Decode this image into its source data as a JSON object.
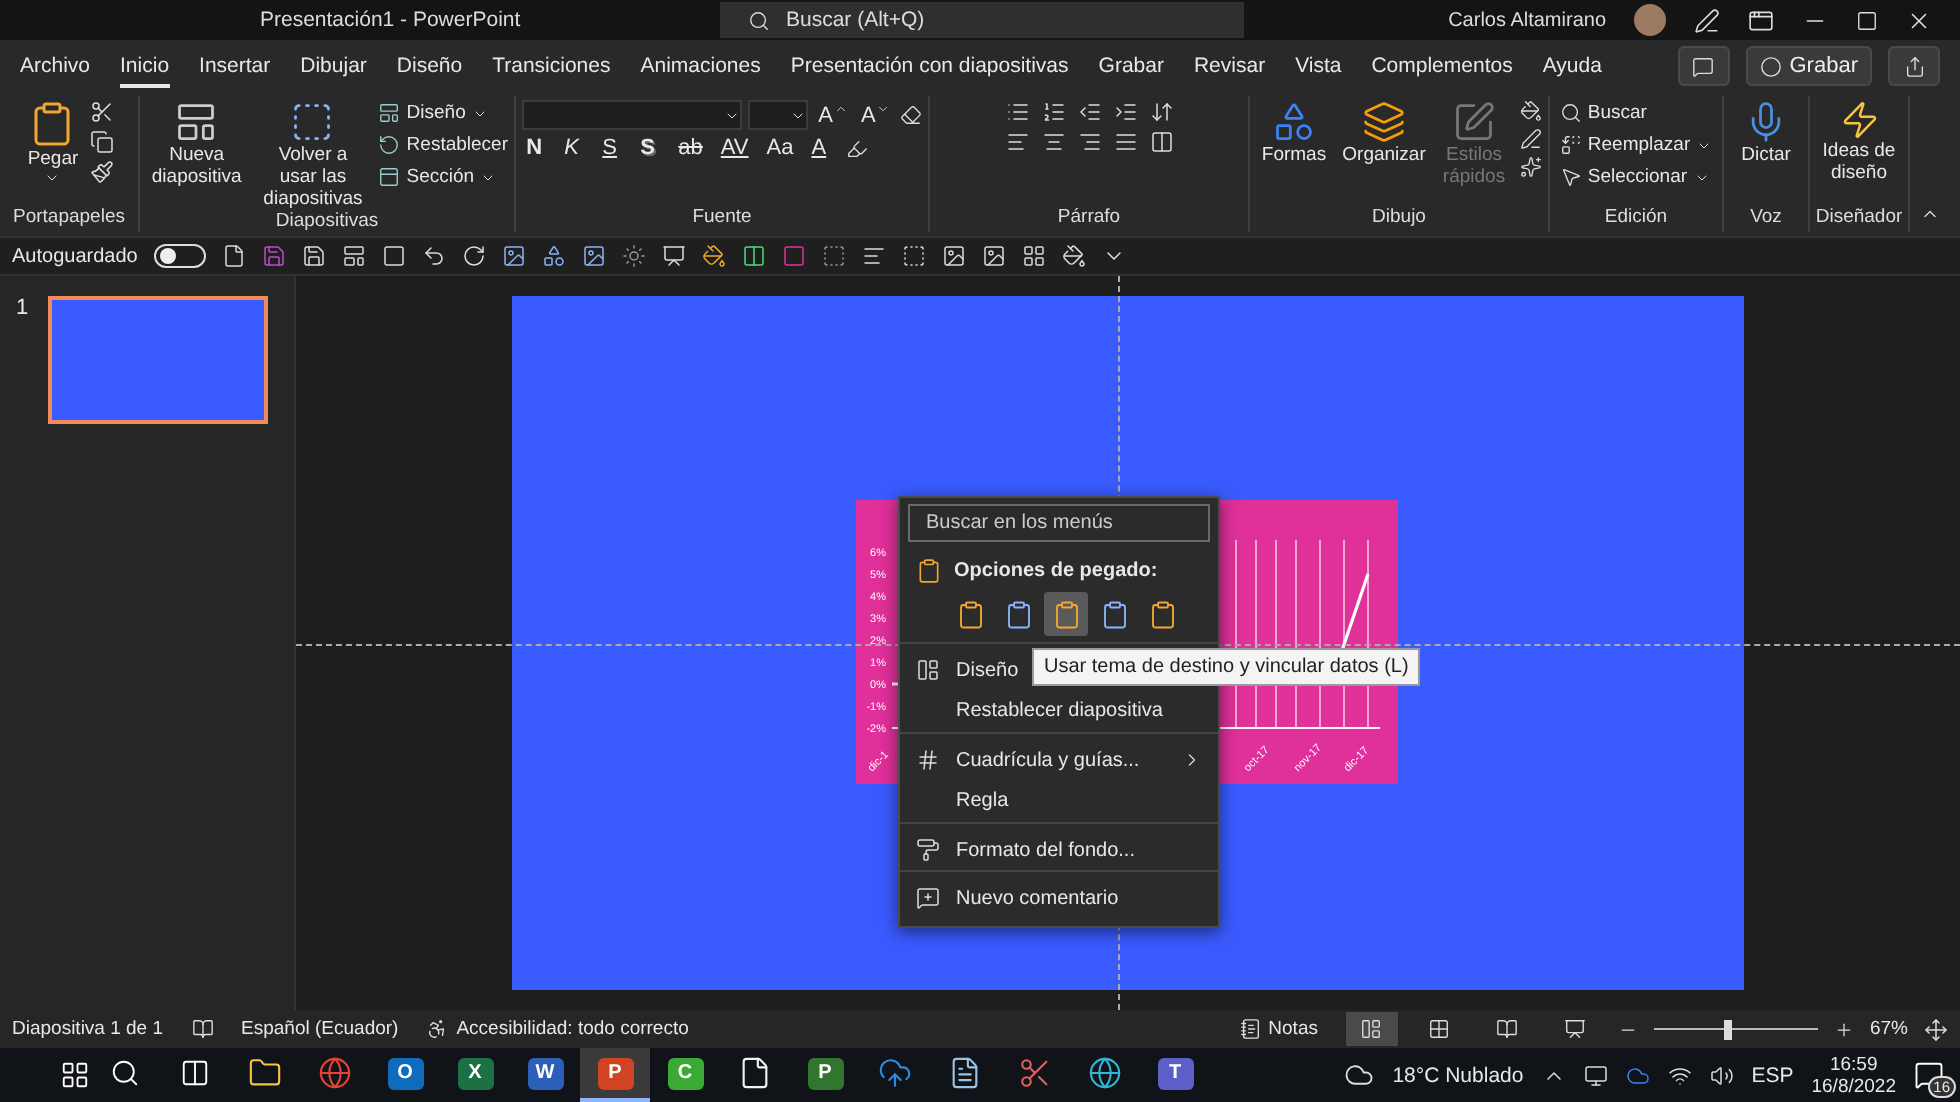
{
  "title_bar": {
    "document_title": "Presentación1  -  PowerPoint",
    "search_placeholder": "Buscar (Alt+Q)",
    "user_name": "Carlos Altamirano"
  },
  "menu_tabs": [
    {
      "label": "Archivo",
      "selected": false
    },
    {
      "label": "Inicio",
      "selected": true
    },
    {
      "label": "Insertar",
      "selected": false
    },
    {
      "label": "Dibujar",
      "selected": false
    },
    {
      "label": "Diseño",
      "selected": false
    },
    {
      "label": "Transiciones",
      "selected": false
    },
    {
      "label": "Animaciones",
      "selected": false
    },
    {
      "label": "Presentación con diapositivas",
      "selected": false
    },
    {
      "label": "Grabar",
      "selected": false
    },
    {
      "label": "Revisar",
      "selected": false
    },
    {
      "label": "Vista",
      "selected": false
    },
    {
      "label": "Complementos",
      "selected": false
    },
    {
      "label": "Ayuda",
      "selected": false
    }
  ],
  "record_button": "Grabar",
  "ribbon": {
    "clipboard": {
      "label": "Portapapeles",
      "paste": "Pegar"
    },
    "slides": {
      "label": "Diapositivas",
      "new_slide": "Nueva diapositiva",
      "reuse": "Volver a usar las diapositivas",
      "small": [
        {
          "label": "Diseño",
          "kind": "layout",
          "dropdown": true
        },
        {
          "label": "Restablecer",
          "kind": "reset",
          "dropdown": false
        },
        {
          "label": "Sección",
          "kind": "section",
          "dropdown": true
        }
      ]
    },
    "font": {
      "label": "Fuente",
      "size_buttons": [
        {
          "label": "A",
          "kind": "grow"
        },
        {
          "label": "A",
          "kind": "shrink"
        }
      ],
      "format_buttons": [
        {
          "label": "N",
          "kind": "bold"
        },
        {
          "label": "K",
          "kind": "italic"
        },
        {
          "label": "S",
          "kind": "underline"
        },
        {
          "label": "S",
          "kind": "shadow"
        },
        {
          "label": "ab",
          "kind": "strike"
        },
        {
          "label": "AV",
          "kind": "spacing"
        },
        {
          "label": "Aa",
          "kind": "case"
        },
        {
          "label": "A",
          "kind": "color"
        }
      ]
    },
    "paragraph": {
      "label": "Párrafo"
    },
    "drawing": {
      "label": "Dibujo",
      "buttons": [
        {
          "label": "Formas",
          "kind": "shapes",
          "disabled": false
        },
        {
          "label": "Organizar",
          "kind": "arrange",
          "disabled": false
        },
        {
          "label": "Estilos rápidos",
          "kind": "styles",
          "disabled": true
        }
      ]
    },
    "editing": {
      "label": "Edición",
      "buttons": [
        {
          "label": "Buscar",
          "kind": "find",
          "dropdown": false
        },
        {
          "label": "Reemplazar",
          "kind": "replace",
          "dropdown": true
        },
        {
          "label": "Seleccionar",
          "kind": "select",
          "dropdown": true
        }
      ]
    },
    "voice": {
      "label": "Voz",
      "button": "Dictar"
    },
    "designer": {
      "label": "Diseñador",
      "button": "Ideas de diseño"
    }
  },
  "quick_access": {
    "autosave_label": "Autoguardado",
    "autosave_on": false
  },
  "slide_panel": {
    "slides": [
      {
        "number": "1",
        "selected": true
      }
    ]
  },
  "slide_chart": {
    "y_labels": [
      "6%",
      "5%",
      "4%",
      "3%",
      "2%",
      "1%",
      "0%",
      "-1%",
      "-2%"
    ],
    "x_labels": [
      "dic-1",
      "oct-17",
      "nov-17",
      "dic-17"
    ]
  },
  "context_menu": {
    "search_placeholder": "Buscar en los menús",
    "paste_heading": "Opciones de pegado:",
    "paste_options": [
      {
        "kind": "text",
        "selected": false
      },
      {
        "kind": "keep",
        "selected": false
      },
      {
        "kind": "link",
        "selected": true
      },
      {
        "kind": "embed",
        "selected": false
      },
      {
        "kind": "picture",
        "selected": false
      }
    ],
    "items": [
      {
        "label": "Diseño",
        "kind": "layout",
        "submenu": false,
        "separator_before": true
      },
      {
        "label": "Restablecer diapositiva",
        "kind": "plain",
        "submenu": false,
        "separator_before": false
      },
      {
        "label": "Cuadrícula y guías...",
        "kind": "grid",
        "submenu": true,
        "separator_before": true
      },
      {
        "label": "Regla",
        "kind": "plain",
        "submenu": false,
        "separator_before": false
      },
      {
        "label": "Formato del fondo...",
        "kind": "background",
        "submenu": false,
        "separator_before": true
      },
      {
        "label": "Nuevo comentario",
        "kind": "comment",
        "submenu": false,
        "separator_before": true
      }
    ]
  },
  "tooltip": "Usar tema de destino y vincular datos (L)",
  "status_bar": {
    "slide_info": "Diapositiva 1 de 1",
    "language": "Español (Ecuador)",
    "accessibility": "Accesibilidad: todo correcto",
    "notes": "Notas",
    "views": [
      {
        "kind": "normal",
        "selected": true
      },
      {
        "kind": "sorter",
        "selected": false
      },
      {
        "kind": "reading",
        "selected": false
      },
      {
        "kind": "presenter",
        "selected": false
      }
    ],
    "zoom": {
      "level": 0.45,
      "reading": "67%"
    }
  },
  "taskbar": {
    "apps": [
      {
        "kind": "explorer",
        "active": false
      },
      {
        "kind": "chrome",
        "active": false
      },
      {
        "kind": "tile",
        "letter": "O",
        "color": "#0f6cbd",
        "active": false
      },
      {
        "kind": "tile",
        "letter": "X",
        "color": "#1d7044",
        "active": false
      },
      {
        "kind": "tile",
        "letter": "W",
        "color": "#2b5fb8",
        "active": false
      },
      {
        "kind": "tile",
        "letter": "P",
        "color": "#d04423",
        "active": true
      },
      {
        "kind": "tile",
        "letter": "C",
        "color": "#3aaa35",
        "active": false
      },
      {
        "kind": "blank",
        "active": false
      },
      {
        "kind": "tile",
        "letter": "P",
        "color": "#31752f",
        "active": false
      },
      {
        "kind": "cloud",
        "active": false
      },
      {
        "kind": "notepad",
        "active": false
      },
      {
        "kind": "snip",
        "active": false
      },
      {
        "kind": "edge",
        "active": false
      },
      {
        "kind": "tile",
        "letter": "T",
        "color": "#5b5fc7",
        "active": false
      }
    ],
    "weather": "18°C  Nublado",
    "language": "ESP",
    "time": "16:59",
    "date": "16/8/2022",
    "notification_count": "16"
  }
}
